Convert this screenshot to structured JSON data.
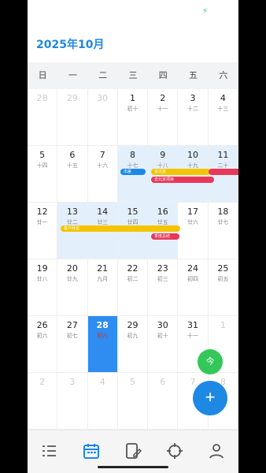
{
  "status": {
    "indicator": "⚡"
  },
  "header": {
    "title": "2025年10月"
  },
  "weekdays": [
    "日",
    "一",
    "二",
    "三",
    "四",
    "五",
    "六"
  ],
  "days": [
    {
      "d": "28",
      "l": "",
      "o": true
    },
    {
      "d": "29",
      "l": "",
      "o": true
    },
    {
      "d": "30",
      "l": "",
      "o": true
    },
    {
      "d": "1",
      "l": "初十"
    },
    {
      "d": "2",
      "l": "十一"
    },
    {
      "d": "3",
      "l": "十二"
    },
    {
      "d": "4",
      "l": "十三"
    },
    {
      "d": "5",
      "l": "十四"
    },
    {
      "d": "6",
      "l": "十五"
    },
    {
      "d": "7",
      "l": "十六"
    },
    {
      "d": "8",
      "l": "十七",
      "h": true
    },
    {
      "d": "9",
      "l": "十八",
      "h": true
    },
    {
      "d": "10",
      "l": "十九",
      "h": true
    },
    {
      "d": "11",
      "l": "二十",
      "h": true
    },
    {
      "d": "12",
      "l": "廿一"
    },
    {
      "d": "13",
      "l": "廿二",
      "h": true
    },
    {
      "d": "14",
      "l": "廿三",
      "h": true
    },
    {
      "d": "15",
      "l": "廿四",
      "h": true
    },
    {
      "d": "16",
      "l": "廿五",
      "h": true
    },
    {
      "d": "17",
      "l": "廿六"
    },
    {
      "d": "18",
      "l": "廿七"
    },
    {
      "d": "19",
      "l": "廿八"
    },
    {
      "d": "20",
      "l": "廿九"
    },
    {
      "d": "21",
      "l": "九月"
    },
    {
      "d": "22",
      "l": "初二"
    },
    {
      "d": "23",
      "l": "初三"
    },
    {
      "d": "24",
      "l": "初四"
    },
    {
      "d": "25",
      "l": "初五"
    },
    {
      "d": "26",
      "l": "初六"
    },
    {
      "d": "27",
      "l": "初七"
    },
    {
      "d": "28",
      "l": "初八",
      "t": true
    },
    {
      "d": "29",
      "l": "初九"
    },
    {
      "d": "30",
      "l": "初十"
    },
    {
      "d": "31",
      "l": "十一"
    },
    {
      "d": "1",
      "l": "",
      "o": true
    },
    {
      "d": "2",
      "l": "",
      "o": true
    },
    {
      "d": "3",
      "l": "",
      "o": true
    },
    {
      "d": "4",
      "l": "",
      "o": true
    },
    {
      "d": "5",
      "l": "",
      "o": true
    },
    {
      "d": "6",
      "l": "",
      "o": true
    },
    {
      "d": "7",
      "l": "",
      "o": true
    },
    {
      "d": "8",
      "l": "",
      "o": true
    }
  ],
  "events": [
    {
      "label": "出差",
      "color": "#1e88e5"
    },
    {
      "label": "会议室",
      "color": "#f5c400"
    },
    {
      "label": "去北京项目",
      "color": "#e8385a"
    },
    {
      "label": "客户拜访",
      "color": "#f5c400"
    },
    {
      "label": "季度总结",
      "color": "#e8385a"
    }
  ],
  "fab": {
    "today_label": "今",
    "add_label": "+"
  },
  "nav": [
    "todo-list-icon",
    "calendar-icon",
    "note-edit-icon",
    "target-icon",
    "profile-icon"
  ],
  "colors": {
    "accent": "#1e88e5",
    "highlight": "#e3f0fb",
    "today_fab": "#34c759"
  }
}
